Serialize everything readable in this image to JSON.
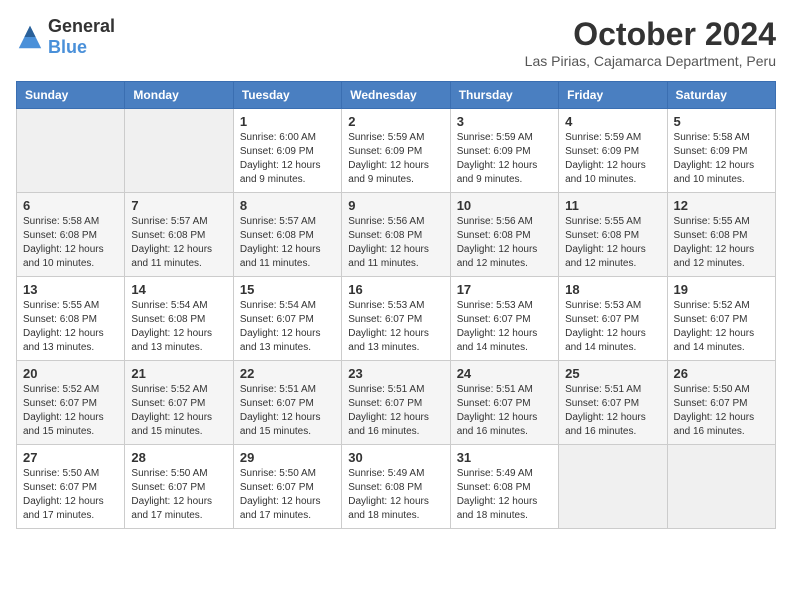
{
  "logo": {
    "general": "General",
    "blue": "Blue"
  },
  "title": "October 2024",
  "subtitle": "Las Pirias, Cajamarca Department, Peru",
  "weekdays": [
    "Sunday",
    "Monday",
    "Tuesday",
    "Wednesday",
    "Thursday",
    "Friday",
    "Saturday"
  ],
  "weeks": [
    [
      {
        "day": "",
        "info": ""
      },
      {
        "day": "",
        "info": ""
      },
      {
        "day": "1",
        "info": "Sunrise: 6:00 AM\nSunset: 6:09 PM\nDaylight: 12 hours and 9 minutes."
      },
      {
        "day": "2",
        "info": "Sunrise: 5:59 AM\nSunset: 6:09 PM\nDaylight: 12 hours and 9 minutes."
      },
      {
        "day": "3",
        "info": "Sunrise: 5:59 AM\nSunset: 6:09 PM\nDaylight: 12 hours and 9 minutes."
      },
      {
        "day": "4",
        "info": "Sunrise: 5:59 AM\nSunset: 6:09 PM\nDaylight: 12 hours and 10 minutes."
      },
      {
        "day": "5",
        "info": "Sunrise: 5:58 AM\nSunset: 6:09 PM\nDaylight: 12 hours and 10 minutes."
      }
    ],
    [
      {
        "day": "6",
        "info": "Sunrise: 5:58 AM\nSunset: 6:08 PM\nDaylight: 12 hours and 10 minutes."
      },
      {
        "day": "7",
        "info": "Sunrise: 5:57 AM\nSunset: 6:08 PM\nDaylight: 12 hours and 11 minutes."
      },
      {
        "day": "8",
        "info": "Sunrise: 5:57 AM\nSunset: 6:08 PM\nDaylight: 12 hours and 11 minutes."
      },
      {
        "day": "9",
        "info": "Sunrise: 5:56 AM\nSunset: 6:08 PM\nDaylight: 12 hours and 11 minutes."
      },
      {
        "day": "10",
        "info": "Sunrise: 5:56 AM\nSunset: 6:08 PM\nDaylight: 12 hours and 12 minutes."
      },
      {
        "day": "11",
        "info": "Sunrise: 5:55 AM\nSunset: 6:08 PM\nDaylight: 12 hours and 12 minutes."
      },
      {
        "day": "12",
        "info": "Sunrise: 5:55 AM\nSunset: 6:08 PM\nDaylight: 12 hours and 12 minutes."
      }
    ],
    [
      {
        "day": "13",
        "info": "Sunrise: 5:55 AM\nSunset: 6:08 PM\nDaylight: 12 hours and 13 minutes."
      },
      {
        "day": "14",
        "info": "Sunrise: 5:54 AM\nSunset: 6:08 PM\nDaylight: 12 hours and 13 minutes."
      },
      {
        "day": "15",
        "info": "Sunrise: 5:54 AM\nSunset: 6:07 PM\nDaylight: 12 hours and 13 minutes."
      },
      {
        "day": "16",
        "info": "Sunrise: 5:53 AM\nSunset: 6:07 PM\nDaylight: 12 hours and 13 minutes."
      },
      {
        "day": "17",
        "info": "Sunrise: 5:53 AM\nSunset: 6:07 PM\nDaylight: 12 hours and 14 minutes."
      },
      {
        "day": "18",
        "info": "Sunrise: 5:53 AM\nSunset: 6:07 PM\nDaylight: 12 hours and 14 minutes."
      },
      {
        "day": "19",
        "info": "Sunrise: 5:52 AM\nSunset: 6:07 PM\nDaylight: 12 hours and 14 minutes."
      }
    ],
    [
      {
        "day": "20",
        "info": "Sunrise: 5:52 AM\nSunset: 6:07 PM\nDaylight: 12 hours and 15 minutes."
      },
      {
        "day": "21",
        "info": "Sunrise: 5:52 AM\nSunset: 6:07 PM\nDaylight: 12 hours and 15 minutes."
      },
      {
        "day": "22",
        "info": "Sunrise: 5:51 AM\nSunset: 6:07 PM\nDaylight: 12 hours and 15 minutes."
      },
      {
        "day": "23",
        "info": "Sunrise: 5:51 AM\nSunset: 6:07 PM\nDaylight: 12 hours and 16 minutes."
      },
      {
        "day": "24",
        "info": "Sunrise: 5:51 AM\nSunset: 6:07 PM\nDaylight: 12 hours and 16 minutes."
      },
      {
        "day": "25",
        "info": "Sunrise: 5:51 AM\nSunset: 6:07 PM\nDaylight: 12 hours and 16 minutes."
      },
      {
        "day": "26",
        "info": "Sunrise: 5:50 AM\nSunset: 6:07 PM\nDaylight: 12 hours and 16 minutes."
      }
    ],
    [
      {
        "day": "27",
        "info": "Sunrise: 5:50 AM\nSunset: 6:07 PM\nDaylight: 12 hours and 17 minutes."
      },
      {
        "day": "28",
        "info": "Sunrise: 5:50 AM\nSunset: 6:07 PM\nDaylight: 12 hours and 17 minutes."
      },
      {
        "day": "29",
        "info": "Sunrise: 5:50 AM\nSunset: 6:07 PM\nDaylight: 12 hours and 17 minutes."
      },
      {
        "day": "30",
        "info": "Sunrise: 5:49 AM\nSunset: 6:08 PM\nDaylight: 12 hours and 18 minutes."
      },
      {
        "day": "31",
        "info": "Sunrise: 5:49 AM\nSunset: 6:08 PM\nDaylight: 12 hours and 18 minutes."
      },
      {
        "day": "",
        "info": ""
      },
      {
        "day": "",
        "info": ""
      }
    ]
  ]
}
